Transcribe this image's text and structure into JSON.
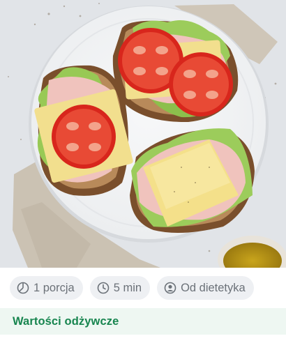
{
  "hero_image": {
    "alt": "Kanapki z szynką, serem, sałatą i pomidorem"
  },
  "meta_chips": [
    {
      "icon": "pie-portion-icon",
      "label": "1 porcja"
    },
    {
      "icon": "clock-icon",
      "label": "5 min"
    },
    {
      "icon": "user-circle-icon",
      "label": "Od dietetyka"
    }
  ],
  "nutrition_section": {
    "title": "Wartości odżywcze"
  }
}
